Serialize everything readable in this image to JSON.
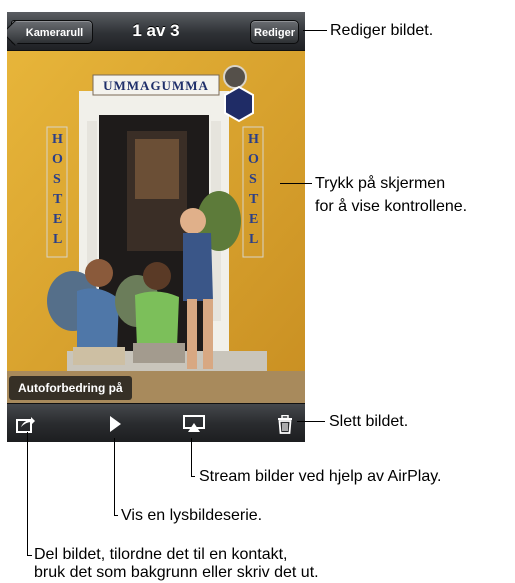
{
  "navbar": {
    "back_label": "Kamerarull",
    "title": "1 av 3",
    "edit_label": "Rediger"
  },
  "photo": {
    "sign_top": "UMMAGUMMA",
    "sign_vertical": "HOSTEL",
    "auto_badge": "Autoforbedring på"
  },
  "toolbar": {
    "icons": [
      "share-icon",
      "play-icon",
      "airplay-icon",
      "trash-icon"
    ]
  },
  "callouts": {
    "edit": "Rediger bildet.",
    "tap_1": "Trykk på skjermen",
    "tap_2": "for å vise kontrollene.",
    "delete": "Slett bildet.",
    "airplay": "Stream bilder ved hjelp av AirPlay.",
    "slideshow": "Vis en lysbildeserie.",
    "share_1": "Del bildet, tilordne det til en kontakt,",
    "share_2": "bruk det som bakgrunn eller skriv det ut."
  },
  "colors": {
    "wall": "#dca42c",
    "bar_dark": "#2a2c2f"
  }
}
